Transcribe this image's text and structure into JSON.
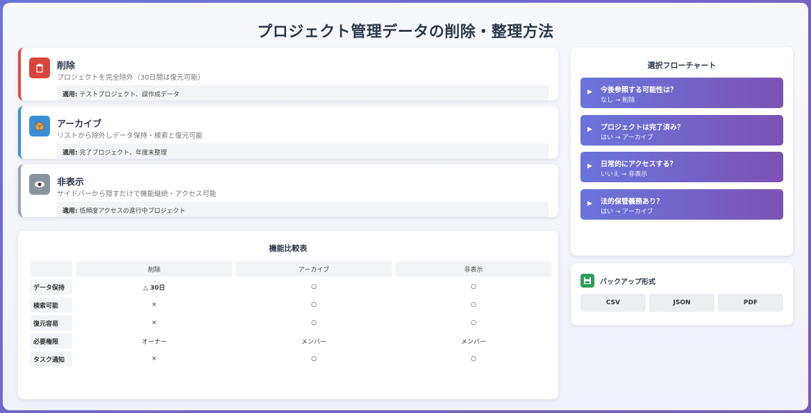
{
  "page": {
    "title": "プロジェクト管理データの削除・整理方法"
  },
  "options": [
    {
      "title": "削除",
      "desc": "プロジェクトを完全除外（30日間は復元可能）",
      "apply_label": "適用:",
      "apply_text": " テストプロジェクト、誤作成データ",
      "icon": "trash-icon",
      "accent": "#e04848",
      "icon_bg": "#d9443c"
    },
    {
      "title": "アーカイブ",
      "desc": "リストから除外しデータ保持・検索と復元可能",
      "apply_label": "適用:",
      "apply_text": " 完了プロジェクト、年度末整理",
      "icon": "box-icon",
      "accent": "#3a8fd8",
      "icon_bg": "#3a8fd8"
    },
    {
      "title": "非表示",
      "desc": "サイドバーから隠すだけで機能継続・アクセス可能",
      "apply_label": "適用:",
      "apply_text": " 低頻度アクセスの進行中プロジェクト",
      "icon": "eye-icon",
      "accent": "#9aa3ad",
      "icon_bg": "#8a949e"
    }
  ],
  "compare": {
    "title": "機能比較表",
    "headers": [
      "",
      "削除",
      "アーカイブ",
      "非表示"
    ],
    "rows": [
      {
        "label": "データ保持",
        "cells": [
          "△ 30日",
          "○",
          "○"
        ]
      },
      {
        "label": "検索可能",
        "cells": [
          "×",
          "○",
          "○"
        ]
      },
      {
        "label": "復元容易",
        "cells": [
          "×",
          "○",
          "○"
        ]
      },
      {
        "label": "必要権限",
        "cells": [
          "オーナー",
          "メンバー",
          "メンバー"
        ]
      },
      {
        "label": "タスク通知",
        "cells": [
          "×",
          "○",
          "○"
        ]
      }
    ]
  },
  "flow": {
    "title": "選択フローチャート",
    "steps": [
      {
        "q": "今後参照する可能性は？",
        "a": "なし → 削除"
      },
      {
        "q": "プロジェクトは完了済み？",
        "a": "はい → アーカイブ"
      },
      {
        "q": "日常的にアクセスする？",
        "a": "いいえ → 非表示"
      },
      {
        "q": "法的保管義務あり？",
        "a": "はい → アーカイブ"
      }
    ]
  },
  "backup": {
    "title": "バックアップ形式",
    "icon": "floppy-disk-icon",
    "formats": [
      "CSV",
      "JSON",
      "PDF"
    ]
  }
}
